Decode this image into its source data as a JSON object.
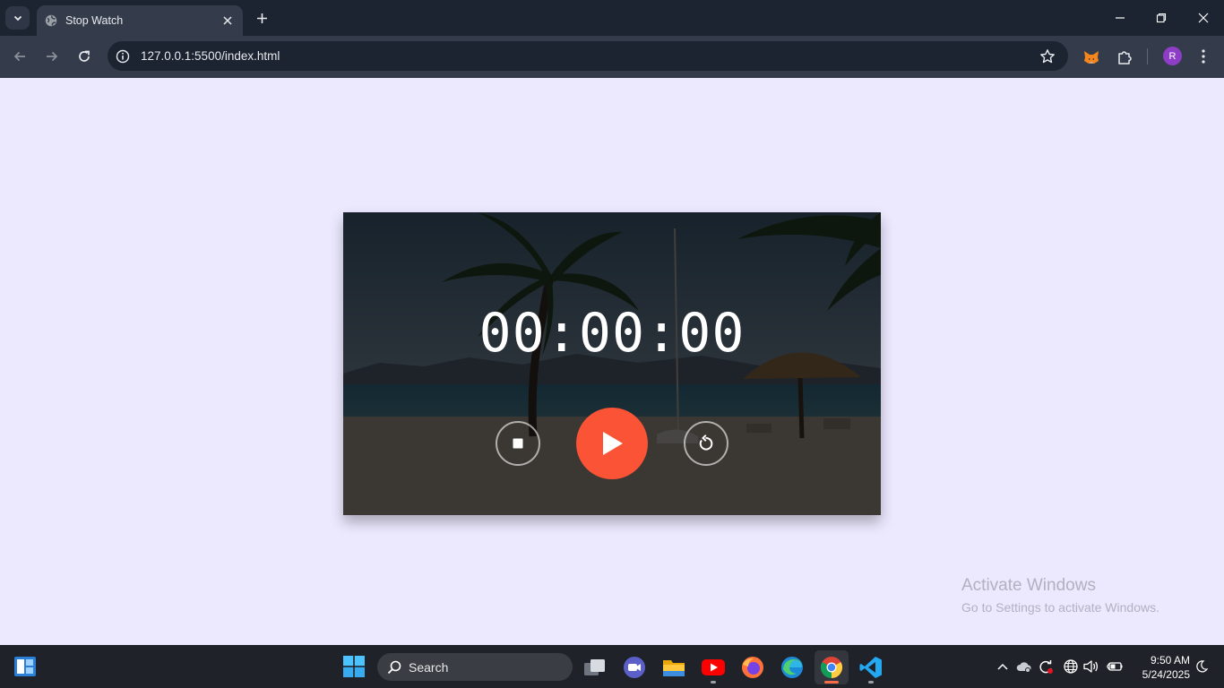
{
  "browser": {
    "tab_title": "Stop Watch",
    "url": "127.0.0.1:5500/index.html",
    "profile_initial": "R"
  },
  "stopwatch": {
    "time": "00:00:00",
    "accent_color": "#fa5335",
    "buttons": [
      "stop-icon",
      "play-icon",
      "reset-icon"
    ]
  },
  "watermark": {
    "title": "Activate Windows",
    "subtitle": "Go to Settings to activate Windows."
  },
  "taskbar": {
    "search_label": "Search",
    "time": "9:50 AM",
    "date": "5/24/2025",
    "pinned_apps": [
      "task-view",
      "meet",
      "file-explorer",
      "youtube",
      "firefox",
      "edge",
      "chrome",
      "vscode"
    ]
  }
}
